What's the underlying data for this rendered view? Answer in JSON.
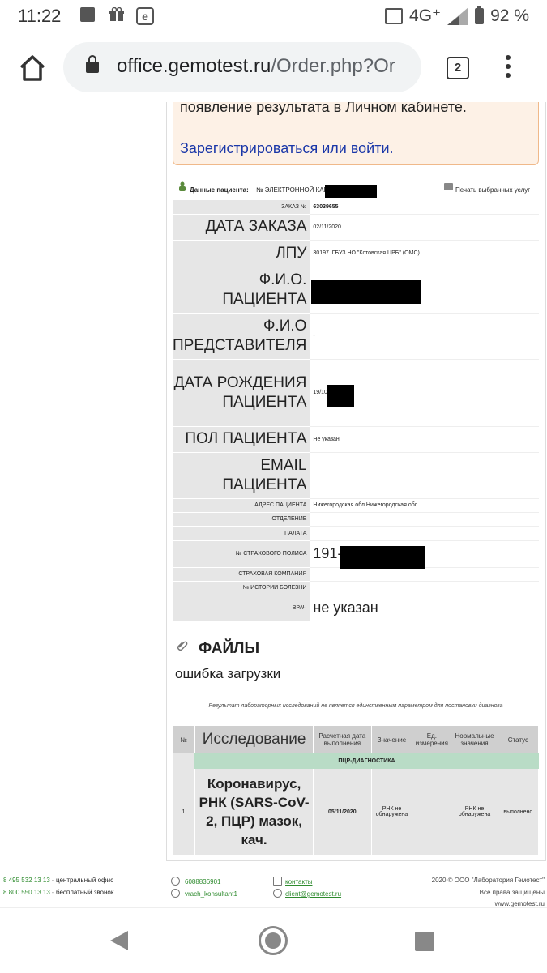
{
  "status_bar": {
    "time": "11:22",
    "network": "4G⁺",
    "battery": "92 %"
  },
  "browser": {
    "url_host": "office.gemotest.ru",
    "url_path": "/Order.php?Or",
    "tab_count": "2"
  },
  "notice": {
    "text": "появление результата в Личном кабинете.",
    "link": "Зарегистрироваться или войти."
  },
  "patient_header": {
    "label": "Данные пациента:",
    "card": "№ ЭЛЕКТРОННОЙ КАРТЫ",
    "print": "Печать выбранных услуг"
  },
  "patient": {
    "order_no_label": "ЗАКАЗ №",
    "order_no": "63039655",
    "order_date_label": "ДАТА ЗАКАЗА",
    "order_date": "02/11/2020",
    "lpu_label": "ЛПУ",
    "lpu": "30197. ГБУЗ НО \"Кстовская ЦРБ\" (ОМС)",
    "fio_label": "Ф.И.О. ПАЦИЕНТА",
    "rep_label": "Ф.И.О ПРЕДСТАВИТЕЛЯ",
    "rep": "-",
    "dob_label": "ДАТА РОЖДЕНИЯ ПАЦИЕНТА",
    "dob": "19/10",
    "sex_label": "ПОЛ ПАЦИЕНТА",
    "sex": "Не указан",
    "email_label": "EMAIL ПАЦИЕНТА",
    "address_label": "АДРЕС ПАЦИЕНТА",
    "address": "Нижегородская обл Нижегородская обл",
    "dept_label": "ОТДЕЛЕНИЕ",
    "ward_label": "ПАЛАТА",
    "policy_label": "№ СТРАХОВОГО ПОЛИСА",
    "policy": "191-",
    "insurer_label": "СТРАХОВАЯ КОМПАНИЯ",
    "history_label": "№ ИСТОРИИ БОЛЕЗНИ",
    "doctor_label": "ВРАЧ",
    "doctor": "не указан"
  },
  "files": {
    "title": "ФАЙЛЫ",
    "error": "ошибка загрузки"
  },
  "disclaimer": "Результат лабораторных исследований не является единственным параметром для постановки диагноза",
  "results": {
    "headers": [
      "№",
      "Исследование",
      "Расчетная дата выполнения",
      "Значение",
      "Ед. измерения",
      "Нормальные значения",
      "Статус"
    ],
    "section": "ПЦР-ДИАГНОСТИКА",
    "rows": [
      {
        "no": "1",
        "name": "Коронавирус, РНК (SARS-CoV-2, ПЦР) мазок, кач.",
        "date": "05/11/2020",
        "value": "РНК не обнаружена",
        "unit": "",
        "norm": "РНК не обнаружена",
        "status": "выполнено"
      }
    ]
  },
  "footer": {
    "phone1": "8 495 532 13 13",
    "phone1_desc": " - центральный офис",
    "phone2": "8 800 550 13 13",
    "phone2_desc": " - бесплатный звонок",
    "icq": "6088836901",
    "skype": "vrach_konsultant1",
    "contacts": "контакты",
    "email": "client@gemotest.ru",
    "copyright": "2020 © ООО \"Лаборатория Гемотест\"",
    "rights": "Все права защищены",
    "site": "www.gemotest.ru"
  }
}
